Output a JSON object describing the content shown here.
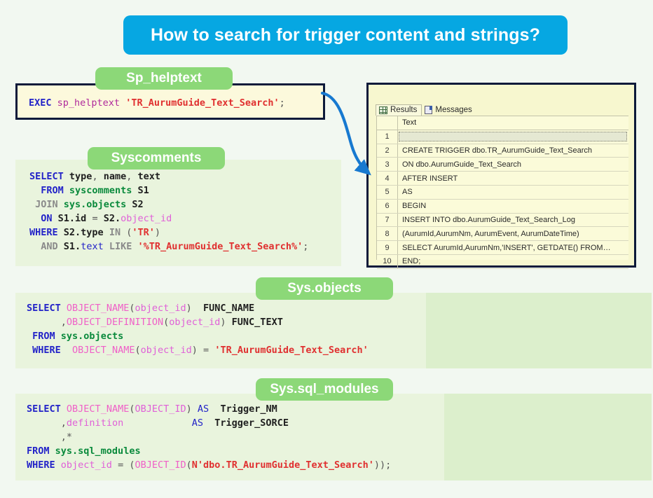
{
  "banner": {
    "title": "How to search for trigger content and strings?",
    "color": "#06a7e2"
  },
  "pills": {
    "sp_helptext": "Sp_helptext",
    "syscomments": "Syscomments",
    "sys_objects": "Sys.objects",
    "sys_sql_modules": "Sys.sql_modules",
    "color": "#8cd878"
  },
  "code_blocks": {
    "helptext": {
      "label": "Sp_helptext",
      "lines": [
        "EXEC sp_helptext 'TR_AurumGuide_Text_Search';"
      ]
    },
    "syscomments": {
      "label": "Syscomments",
      "lines": [
        "SELECT type, name, text",
        "  FROM syscomments S1",
        " JOIN sys.objects S2",
        "  ON S1.id = S2.object_id",
        "WHERE S2.type IN ('TR')",
        "  AND S1.text LIKE '%TR_AurumGuide_Text_Search%';"
      ]
    },
    "sys_objects": {
      "label": "Sys.objects",
      "lines": [
        "SELECT OBJECT_NAME(object_id)  FUNC_NAME",
        "      ,OBJECT_DEFINITION(object_id) FUNC_TEXT",
        " FROM sys.objects",
        " WHERE  OBJECT_NAME(object_id) = 'TR_AurumGuide_Text_Search'"
      ]
    },
    "sys_sql_modules": {
      "label": "Sys.sql_modules",
      "lines": [
        "SELECT OBJECT_NAME(OBJECT_ID) AS  Trigger_NM",
        "      ,definition            AS  Trigger_SORCE",
        "      ,*",
        "FROM sys.sql_modules",
        "WHERE object_id = (OBJECT_ID(N'dbo.TR_AurumGuide_Text_Search'));"
      ]
    }
  },
  "results_panel": {
    "tabs": [
      {
        "label": "Results",
        "icon": "grid-icon",
        "active": true
      },
      {
        "label": "Messages",
        "icon": "document-icon",
        "active": false
      }
    ],
    "column_header": "Text",
    "rows": [
      {
        "num": "1",
        "text": ""
      },
      {
        "num": "2",
        "text": "CREATE   TRIGGER dbo.TR_AurumGuide_Text_Search"
      },
      {
        "num": "3",
        "text": "ON dbo.AurumGuide_Text_Search"
      },
      {
        "num": "4",
        "text": "AFTER INSERT"
      },
      {
        "num": "5",
        "text": "AS"
      },
      {
        "num": "6",
        "text": "BEGIN"
      },
      {
        "num": "7",
        "text": "INSERT INTO dbo.AurumGuide_Text_Search_Log"
      },
      {
        "num": "8",
        "text": "  (AurumId,AurumNm, AurumEvent, AurumDateTime)"
      },
      {
        "num": "9",
        "text": "SELECT AurumId,AurumNm,'INSERT', GETDATE() FROM…"
      },
      {
        "num": "10",
        "text": "END;"
      }
    ]
  },
  "connector": {
    "name": "arrow-helptext-to-results",
    "color": "#1779d0"
  }
}
